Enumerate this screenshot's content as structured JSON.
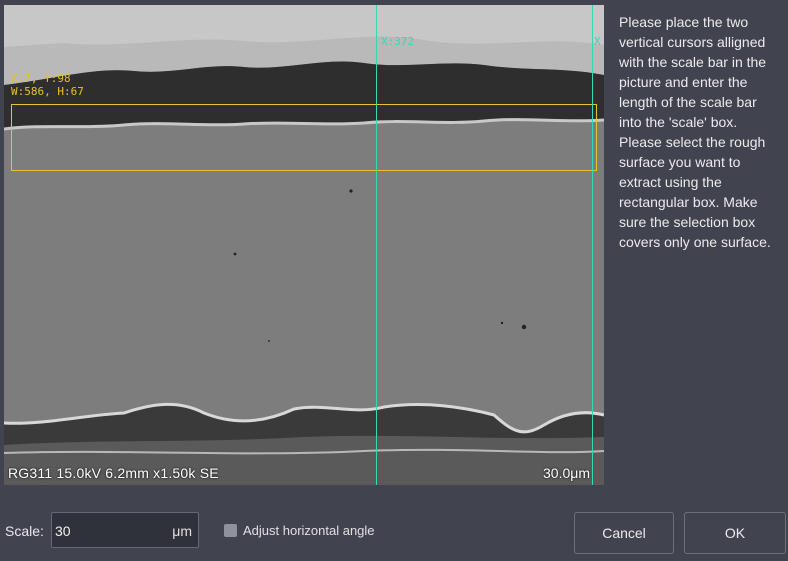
{
  "image": {
    "selection_readout_line1": "X:7, Y:98",
    "selection_readout_line2": "W:586, H:67",
    "cursor_left_label": "X:372",
    "cursor_right_label": "X",
    "sem_info": "RG311 15.0kV 6.2mm x1.50k SE",
    "sem_scale": "30.0μm"
  },
  "instructions": "Please place the two vertical cursors alligned with the scale bar in the picture and enter the length of the scale bar into the 'scale' box. Please select the rough surface you want to extract using the rectangular box. Make sure the selection box covers only one surface.",
  "controls": {
    "scale_label": "Scale:",
    "scale_value": "30",
    "scale_unit": "μm",
    "adjust_angle_label": "Adjust horizontal angle",
    "adjust_angle_checked": false,
    "cancel_label": "Cancel",
    "ok_label": "OK"
  },
  "colors": {
    "cursor": "#36d7b3",
    "selection_box": "#e9c22a",
    "background": "#41444e"
  }
}
